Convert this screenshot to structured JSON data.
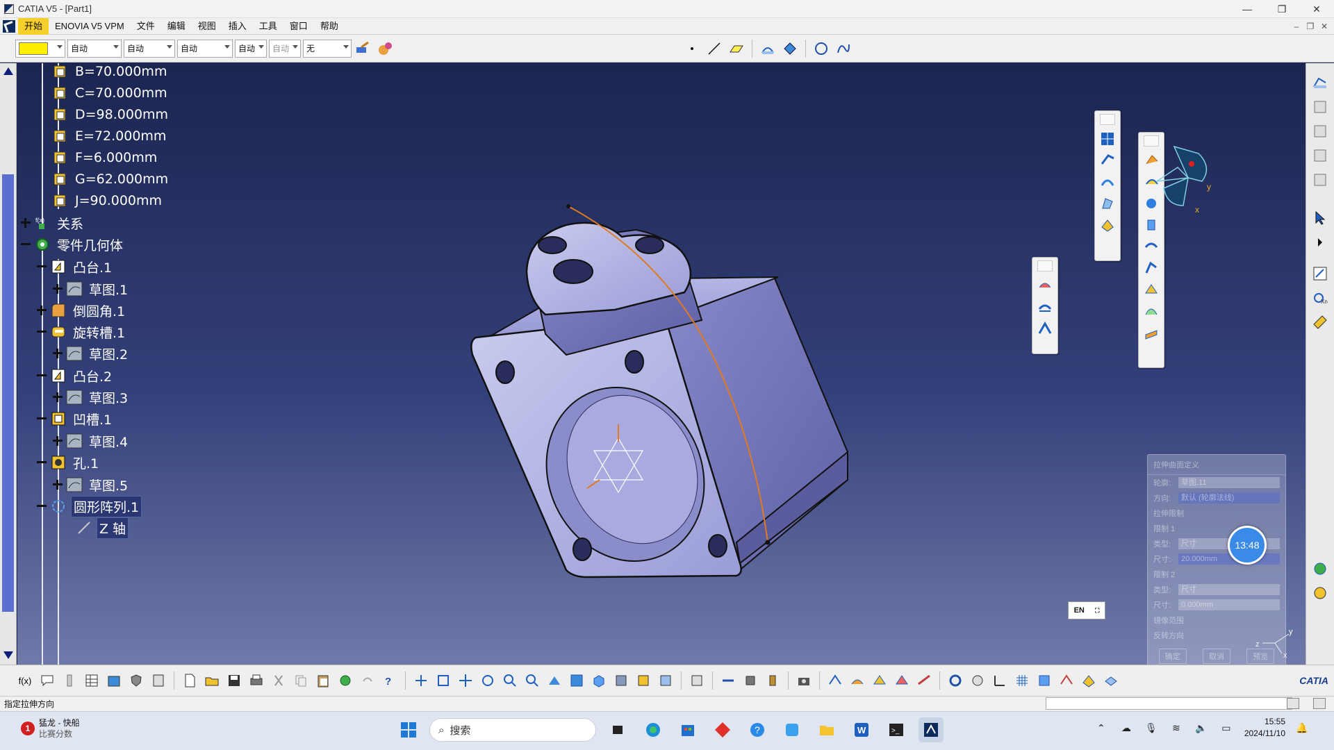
{
  "window": {
    "title": "CATIA V5 - [Part1]",
    "controls": [
      "—",
      "❐",
      "✕"
    ]
  },
  "menu": {
    "items": [
      "开始",
      "ENOVIA V5 VPM",
      "文件",
      "编辑",
      "视图",
      "插入",
      "工具",
      "窗口",
      "帮助"
    ],
    "mdi_controls": [
      "–",
      "❐",
      "✕"
    ]
  },
  "toolbar": {
    "color_swatch": "#ffee00",
    "dropdowns": [
      {
        "value": "自动",
        "disabled": false
      },
      {
        "value": "自动",
        "disabled": false
      },
      {
        "value": "自动",
        "disabled": false
      },
      {
        "value": "自动",
        "disabled": false
      },
      {
        "value": "自动",
        "disabled": true
      },
      {
        "value": "无",
        "disabled": false
      }
    ]
  },
  "tree": {
    "parameters": [
      {
        "label": "B=70.000mm"
      },
      {
        "label": "C=70.000mm"
      },
      {
        "label": "D=98.000mm"
      },
      {
        "label": "E=72.000mm"
      },
      {
        "label": "F=6.000mm"
      },
      {
        "label": "G=62.000mm"
      },
      {
        "label": "J=90.000mm"
      }
    ],
    "relations": "关系",
    "part_body": "零件几何体",
    "features": [
      {
        "label": "凸台.1",
        "level": 1,
        "expander": "minus",
        "icon": "pad-icon"
      },
      {
        "label": "草图.1",
        "level": 2,
        "expander": "plus",
        "icon": "sketch-icon"
      },
      {
        "label": "倒圆角.1",
        "level": 1,
        "expander": "plus",
        "icon": "fillet-icon"
      },
      {
        "label": "旋转槽.1",
        "level": 1,
        "expander": "minus",
        "icon": "groove-icon"
      },
      {
        "label": "草图.2",
        "level": 2,
        "expander": "plus",
        "icon": "sketch-icon"
      },
      {
        "label": "凸台.2",
        "level": 1,
        "expander": "minus",
        "icon": "pad-icon"
      },
      {
        "label": "草图.3",
        "level": 2,
        "expander": "plus",
        "icon": "sketch-icon"
      },
      {
        "label": "凹槽.1",
        "level": 1,
        "expander": "minus",
        "icon": "pocket-icon"
      },
      {
        "label": "草图.4",
        "level": 2,
        "expander": "plus",
        "icon": "sketch-icon"
      },
      {
        "label": "孔.1",
        "level": 1,
        "expander": "minus",
        "icon": "hole-icon"
      },
      {
        "label": "草图.5",
        "level": 2,
        "expander": "plus",
        "icon": "sketch-icon"
      },
      {
        "label": "圆形阵列.1",
        "level": 1,
        "expander": "minus",
        "icon": "circular-pattern-icon"
      },
      {
        "label": "Z 轴",
        "level": 2,
        "expander": "none",
        "icon": "axis-icon"
      }
    ]
  },
  "dialog": {
    "title": "拉伸曲面定义",
    "rows": [
      {
        "k": "轮廓:",
        "v": "草图.11",
        "sel": false
      },
      {
        "k": "方向:",
        "v": "默认 (轮廓法线)",
        "sel": true
      },
      {
        "k": "拉伸限制",
        "v": "",
        "sel": false
      },
      {
        "k": "限制 1",
        "v": "",
        "sel": false
      },
      {
        "k": "类型:",
        "v": "尺寸",
        "sel": false
      },
      {
        "k": "尺寸:",
        "v": "20.000mm",
        "sel": true
      },
      {
        "k": "限制 2",
        "v": "",
        "sel": false
      },
      {
        "k": "类型:",
        "v": "尺寸",
        "sel": false
      },
      {
        "k": "尺寸:",
        "v": "0.000mm",
        "sel": false
      }
    ],
    "mirror": "镜像范围",
    "reverse": "反转方向",
    "buttons": [
      "确定",
      "取消",
      "预览"
    ]
  },
  "timer": "13:48",
  "lang": "EN",
  "compass": {
    "x": "x",
    "y": "y",
    "z": "z"
  },
  "status": {
    "text": "指定拉伸方向"
  },
  "taskbar": {
    "weather_badge": "1",
    "weather_title": "猛龙 - 快船",
    "weather_sub": "比赛分数",
    "search_placeholder": "搜索",
    "time": "15:55",
    "date": "2024/11/10"
  },
  "brand": "CATIA"
}
